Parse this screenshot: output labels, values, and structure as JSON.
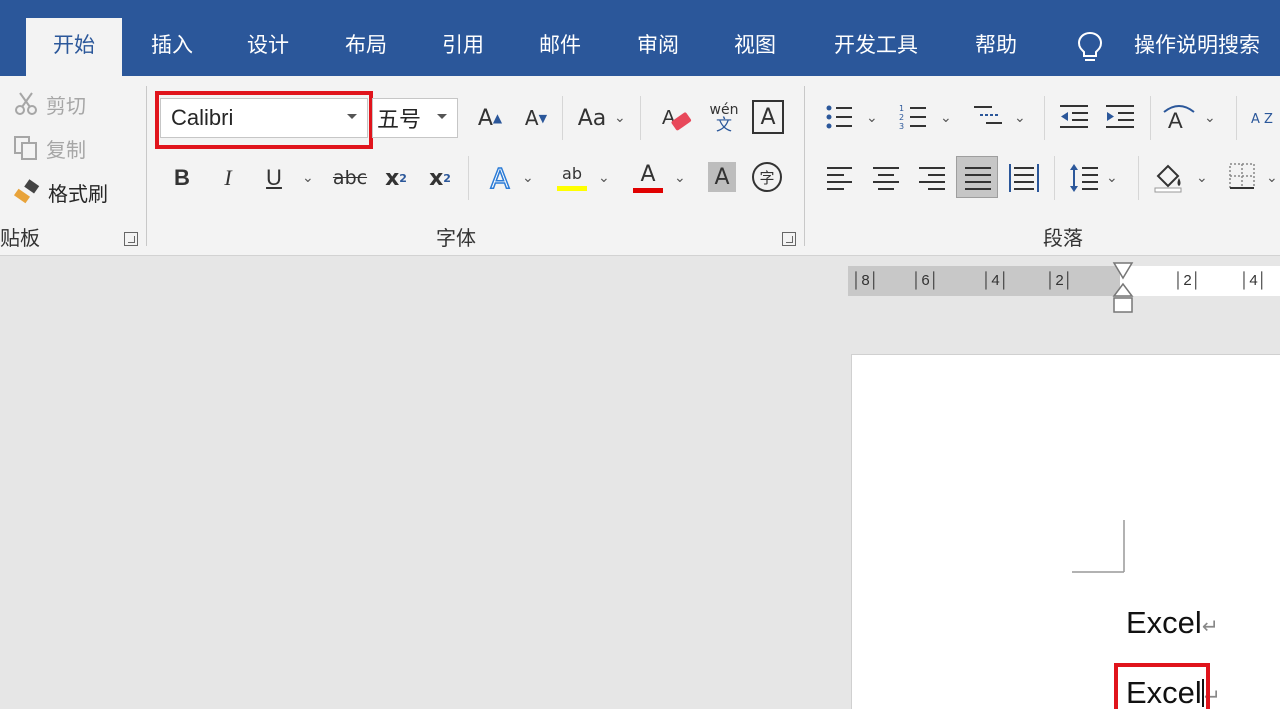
{
  "ribbon_tabs": [
    {
      "label": "开始",
      "active": true
    },
    {
      "label": "插入"
    },
    {
      "label": "设计"
    },
    {
      "label": "布局"
    },
    {
      "label": "引用"
    },
    {
      "label": "邮件"
    },
    {
      "label": "审阅"
    },
    {
      "label": "视图"
    },
    {
      "label": "开发工具"
    },
    {
      "label": "帮助"
    }
  ],
  "tell_me": {
    "icon": "lightbulb-icon",
    "label": "操作说明搜索"
  },
  "clipboard": {
    "cut": "剪切",
    "copy": "复制",
    "format_painter": "格式刷",
    "group_label": "贴板"
  },
  "font_group": {
    "font_name": "Calibri",
    "font_size": "五号",
    "grow": "A",
    "shrink": "A",
    "change_case": "Aa",
    "phonetic_top": "wén",
    "phonetic_bottom": "文",
    "char_border": "A",
    "bold": "B",
    "italic": "I",
    "underline": "U",
    "strike": "abc",
    "subscript": "x",
    "subscript_mark": "2",
    "superscript": "x",
    "superscript_mark": "2",
    "text_effects": "A",
    "highlight": "ab",
    "font_color": "A",
    "char_shading": "A",
    "enclose": "字",
    "group_label": "字体"
  },
  "paragraph_group": {
    "group_label": "段落",
    "sort_label": "A Z"
  },
  "ruler_marks": [
    "8",
    "6",
    "4",
    "2",
    "2",
    "4"
  ],
  "document": {
    "lines": [
      "Excel",
      "Excel"
    ],
    "para_mark": "↵"
  },
  "colors": {
    "brand": "#2b579a",
    "highlight_red": "#e0141c",
    "highlight_yellow": "#ffff00",
    "font_color_red": "#e00000"
  }
}
